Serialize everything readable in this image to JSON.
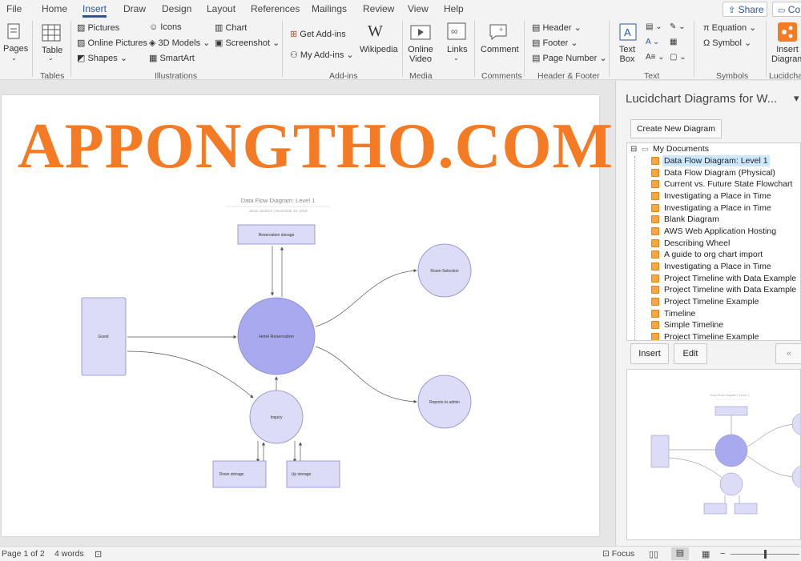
{
  "menu": {
    "tabs": [
      "File",
      "Home",
      "Insert",
      "Draw",
      "Design",
      "Layout",
      "References",
      "Mailings",
      "Review",
      "View",
      "Help"
    ],
    "active_tab": "Insert",
    "share_label": "Share",
    "comments_label": "Co"
  },
  "ribbon": {
    "pages_label": "Pages",
    "table_label": "Table",
    "tables_group": "Tables",
    "pictures_label": "Pictures",
    "online_pictures_label": "Online Pictures",
    "shapes_label": "Shapes",
    "icons_label": "Icons",
    "models_label": "3D Models",
    "smartart_label": "SmartArt",
    "chart_label": "Chart",
    "screenshot_label": "Screenshot",
    "illustrations_group": "Illustrations",
    "get_addins_label": "Get Add-ins",
    "my_addins_label": "My Add-ins",
    "wikipedia_label": "Wikipedia",
    "addins_group": "Add-ins",
    "online_video_label": "Online Video",
    "links_label": "Links",
    "media_group": "Media",
    "comment_label": "Comment",
    "comments_group": "Comments",
    "header_label": "Header",
    "footer_label": "Footer",
    "page_number_label": "Page Number",
    "header_footer_group": "Header & Footer",
    "text_box_label": "Text Box",
    "text_group": "Text",
    "equation_label": "Equation",
    "symbol_label": "Symbol",
    "symbols_group": "Symbols",
    "insert_diagram_label": "Insert Diagram",
    "lucidchart_group": "Lucidchar"
  },
  "watermark": "APPONGTHO.COM",
  "diagram": {
    "title": "Data Flow Diagram: Level 1",
    "subtitle": "Jamie Jackson  |  November 15, 2018",
    "nodes": {
      "reservation_storage": "Reservation storage",
      "guest": "Guest",
      "hotel_reservation": "Hotel Reservation",
      "room_selection": "Room Selection",
      "reports_to_admin": "Reports to admin",
      "inquiry": "Inquiry",
      "down_storage": "Down storage",
      "up_storage": "Up storage"
    }
  },
  "pane": {
    "title": "Lucidchart Diagrams for W...",
    "create_button": "Create New Diagram",
    "tree_root": "My Documents",
    "items": [
      "Data Flow Diagram: Level 1",
      "Data Flow Diagram (Physical)",
      "Current vs. Future State Flowchart",
      "Investigating a Place in Time",
      "Investigating a Place in Time",
      "Blank Diagram",
      "AWS Web Application Hosting",
      "Describing Wheel",
      "A guide to org chart import",
      "Investigating a Place in Time",
      "Project Timeline with Data Example",
      "Project Timeline with Data Example",
      "Project Timeline Example",
      "Timeline",
      "Simple Timeline",
      "Project Timeline Example"
    ],
    "selected_index": 0,
    "insert_button": "Insert",
    "edit_button": "Edit",
    "collapse_button": "«"
  },
  "status": {
    "page": "Page 1 of 2",
    "words": "4 words",
    "focus": "Focus"
  },
  "colors": {
    "accent": "#2b579a",
    "watermark": "#f47a23",
    "node_fill": "#dcdcf7",
    "node_fill_dark": "#a9a9f0",
    "node_stroke": "#8888cc"
  }
}
